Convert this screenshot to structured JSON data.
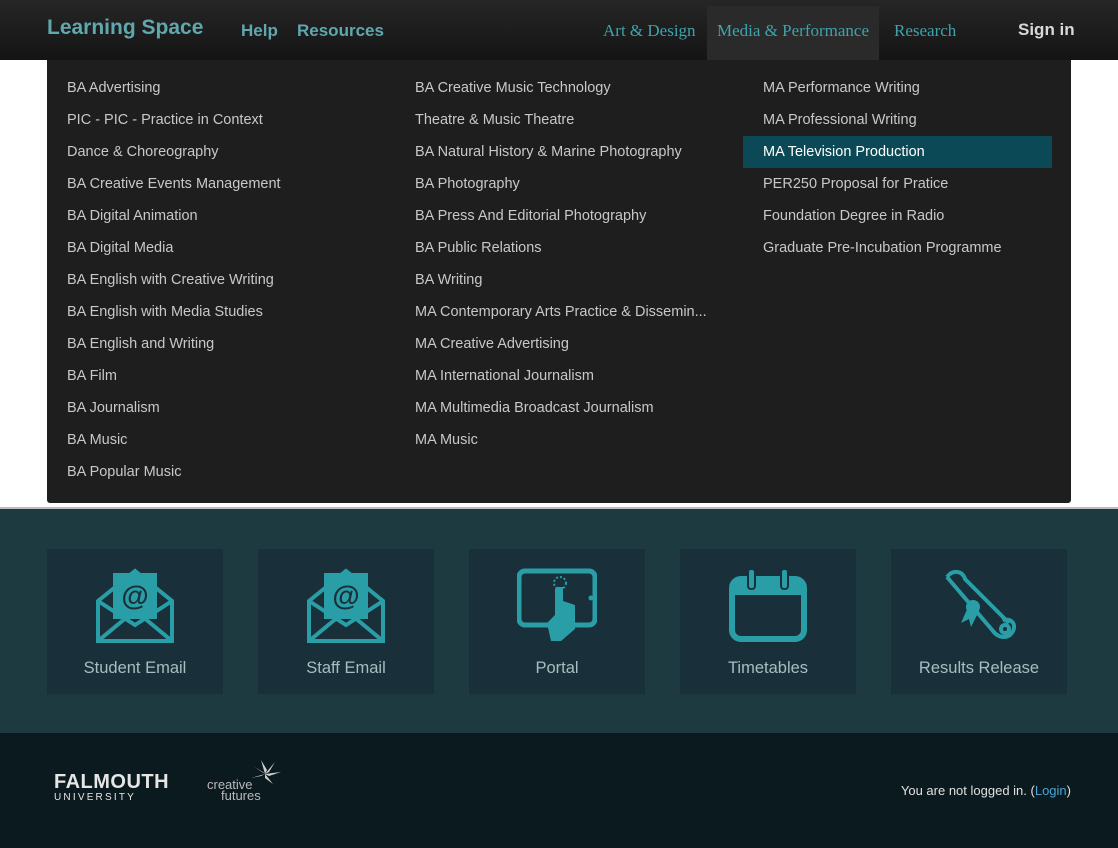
{
  "header": {
    "brand": "Learning Space",
    "links": [
      "Help",
      "Resources"
    ],
    "categories": [
      "Art & Design",
      "Media & Performance",
      "Research"
    ],
    "active_category": "Media & Performance",
    "signin": "Sign in"
  },
  "menu": {
    "columns": [
      [
        "BA Advertising",
        "PIC - PIC - Practice in Context",
        "Dance & Choreography",
        "BA Creative Events Management",
        "BA Digital Animation",
        "BA Digital Media",
        "BA English with Creative Writing",
        "BA English with Media Studies",
        "BA English and Writing",
        "BA Film",
        "BA Journalism",
        "BA Music",
        "BA Popular Music"
      ],
      [
        "BA Creative Music Technology",
        "Theatre & Music Theatre",
        "BA Natural History & Marine Photography",
        "BA Photography",
        "BA Press And Editorial Photography",
        "BA Public Relations",
        "BA Writing",
        "MA Contemporary Arts Practice & Dissemin...",
        "MA Creative Advertising",
        "MA International Journalism",
        "MA Multimedia Broadcast Journalism",
        "MA Music"
      ],
      [
        "MA Performance Writing",
        "MA Professional Writing",
        "MA Television Production",
        "PER250 Proposal for Pratice",
        "Foundation Degree in Radio",
        "Graduate Pre-Incubation Programme"
      ]
    ],
    "selected_item": "MA Television Production"
  },
  "quicklinks": [
    {
      "label": "Student Email",
      "icon": "email-icon"
    },
    {
      "label": "Staff Email",
      "icon": "email-icon"
    },
    {
      "label": "Portal",
      "icon": "tablet-touch-icon"
    },
    {
      "label": "Timetables",
      "icon": "calendar-icon"
    },
    {
      "label": "Results Release",
      "icon": "diploma-scroll-icon"
    }
  ],
  "footer": {
    "logo_main": "FALMOUTH",
    "logo_sub": "UNIVERSITY",
    "partner_line1": "creative",
    "partner_line2": "futures",
    "login_prefix": "You are not logged in. (",
    "login_link": "Login",
    "login_suffix": ")"
  },
  "colors": {
    "accent": "#3ea3ad",
    "selected_bg": "#0b4956",
    "band_bg": "#1e3a41",
    "card_bg": "#19303a",
    "icon": "#2a9ea6",
    "footer_bg": "#0b1a1e"
  }
}
